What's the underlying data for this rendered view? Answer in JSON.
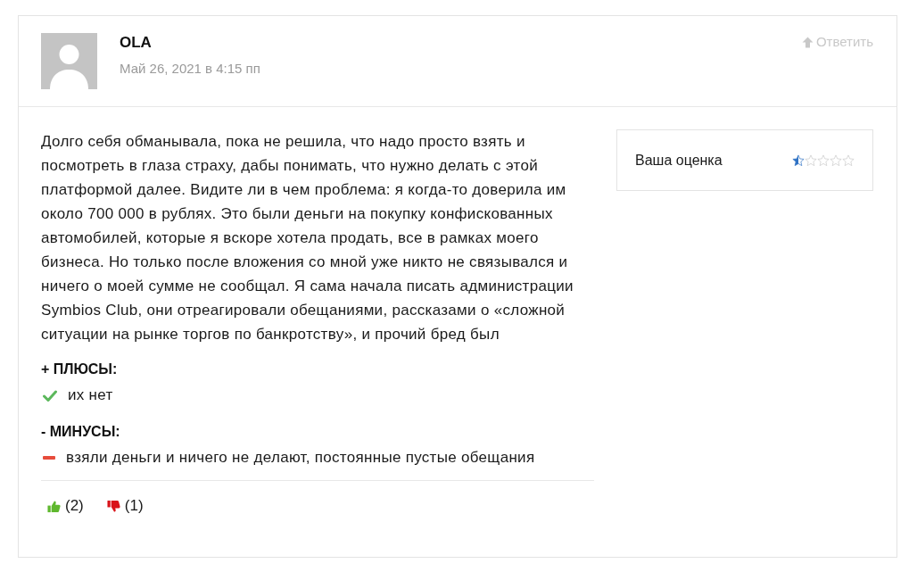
{
  "comment": {
    "author": "OLA",
    "date": "Май 26, 2021 в 4:15 пп",
    "reply_link": "Ответить",
    "text": "Долго себя обманывала, пока не решила, что надо просто взять и посмотреть в глаза страху, дабы понимать, что нужно делать с этой платформой далее. Видите ли в чем проблема: я когда-то доверила им около 700 000 в рублях. Это были деньги на покупку конфискованных автомобилей, которые я вскоре хотела продать, все в рамках моего бизнеса. Но только после вложения со мной уже никто не связывался и ничего о моей сумме не сообщал. Я сама начала писать администрации Symbios Club, они отреагировали обещаниями, рассказами о «сложной ситуации на рынке торгов по банкротству», и прочий бред был",
    "rating": {
      "label": "Ваша оценка",
      "stars": 0.5
    },
    "sections": [
      {
        "kind": "pros",
        "title": "+ ПЛЮСЫ:",
        "items": [
          "их нет"
        ]
      },
      {
        "kind": "cons",
        "title": "- МИНУСЫ:",
        "items": [
          "взяли деньги и ничего не делают, постоянные пустые обещания"
        ]
      }
    ],
    "votes": [
      {
        "kind": "up",
        "count": "(2)"
      },
      {
        "kind": "down",
        "count": "(1)"
      }
    ]
  }
}
